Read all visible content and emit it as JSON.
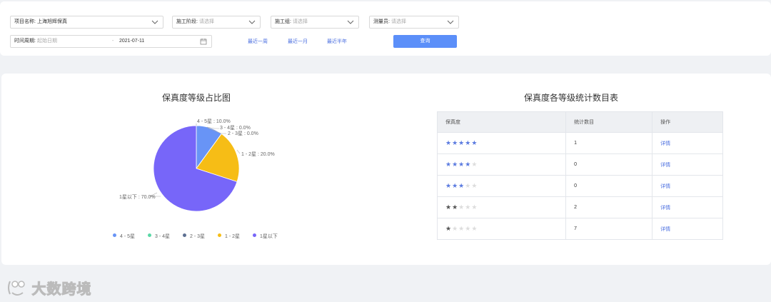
{
  "filters": {
    "project": {
      "label": "项目名称:",
      "value": "上海旭辉保真"
    },
    "stage": {
      "label": "施工阶段:",
      "placeholder": "请选择"
    },
    "group": {
      "label": "施工组:",
      "placeholder": "请选择"
    },
    "surveyor": {
      "label": "测量员:",
      "placeholder": "请选择"
    },
    "period": {
      "label": "时间周期:",
      "start_placeholder": "起始日期",
      "end_value": "2021-07-11"
    },
    "quick_ranges": [
      "最近一周",
      "最近一月",
      "最近半年"
    ],
    "query_button": "查询"
  },
  "pie": {
    "title": "保真度等级占比图",
    "labels": [
      "4 - 5星 : 10.0%",
      "3 - 4星 : 0.0%",
      "2 - 3星 : 0.0%",
      "1 - 2星 : 20.0%",
      "1星以下 : 70.0%"
    ],
    "legend": [
      "4 - 5星",
      "3 - 4星",
      "2 - 3星",
      "1 - 2星",
      "1星以下"
    ]
  },
  "chart_data": {
    "type": "pie",
    "categories": [
      "4 - 5星",
      "3 - 4星",
      "2 - 3星",
      "1 - 2星",
      "1星以下"
    ],
    "values": [
      10.0,
      0.0,
      0.0,
      20.0,
      70.0
    ],
    "colors": [
      "#6894f6",
      "#5ad8a6",
      "#5d7092",
      "#f6bd16",
      "#7766f9"
    ],
    "title": "保真度等级占比图",
    "legend_position": "bottom"
  },
  "table": {
    "title": "保真度各等级统计数目表",
    "headers": [
      "保真度",
      "统计数目",
      "操作"
    ],
    "rows": [
      {
        "stars": 5,
        "count": "1",
        "action": "详情"
      },
      {
        "stars": 4,
        "count": "0",
        "action": "详情"
      },
      {
        "stars": 3,
        "count": "0",
        "action": "详情"
      },
      {
        "stars": 2,
        "count": "2",
        "action": "详情"
      },
      {
        "stars": 1,
        "count": "7",
        "action": "详情"
      }
    ],
    "star_colors": {
      "high": "#5b7be0",
      "low": "#555555",
      "empty": "#dddddd"
    }
  },
  "watermark": {
    "text": "大数跨境"
  }
}
